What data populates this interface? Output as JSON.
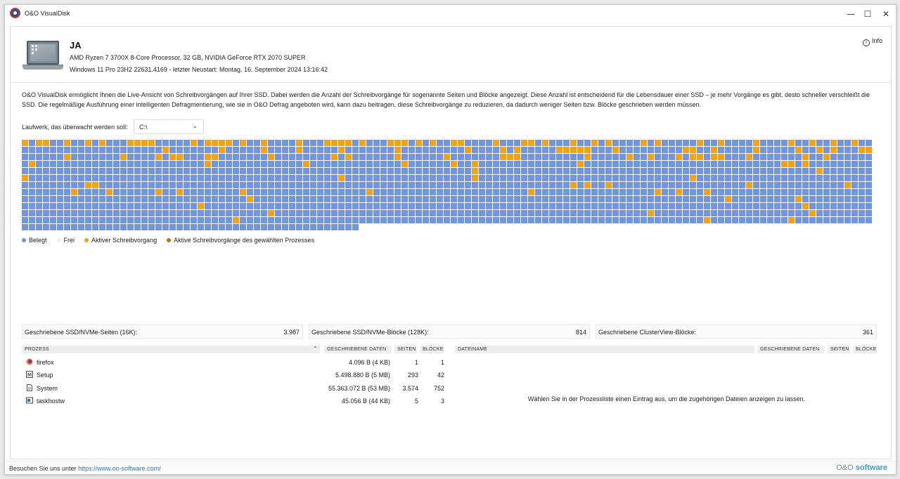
{
  "window": {
    "title": "O&O VisualDisk",
    "minimize_icon": "minimize-icon",
    "maximize_icon": "maximize-icon",
    "close_icon": "close-icon"
  },
  "system": {
    "hostname": "JA",
    "hardware": "AMD Ryzen 7 3700X 8-Core Processor, 32 GB, NVIDIA GeForce RTX 2070 SUPER",
    "os": "Windows 11 Pro 23H2 22631.4169 - letzter Neustart: Montag, 16. September 2024 13:16:42"
  },
  "info_label": "Info",
  "description": "O&O VisualDisk ermöglicht Ihnen die Live-Ansicht von Schreibvorgängen auf Ihrer SSD. Dabei werden die Anzahl der Schreibvorgänge für sogenannte Seiten und Blöcke angezeigt. Diese Anzahl ist entscheidend für die Lebensdauer einer SSD – je mehr Vorgänge es gibt, desto schneller verschleißt die SSD. Die regelmäßige Ausführung einer intelligenten Defragmentierung, wie sie in O&O Defrag angeboten wird, kann dazu beitragen, diese Schreibvorgänge zu reduzieren, da dadurch weniger Seiten bzw. Blöcke geschrieben werden müssen.",
  "drive": {
    "label": "Laufwerk, das überwacht werden soll:",
    "selected": "C:\\"
  },
  "cluster_map": {
    "columns": 121,
    "full_rows": 12,
    "last_row_cells": 48,
    "colors": {
      "used": "#6f95e4",
      "active": "#f6a20a"
    },
    "active_cells": [
      [
        0,
        0
      ],
      [
        0,
        2
      ],
      [
        0,
        3
      ],
      [
        0,
        6
      ],
      [
        0,
        9
      ],
      [
        0,
        11
      ],
      [
        0,
        15
      ],
      [
        0,
        16
      ],
      [
        0,
        17
      ],
      [
        0,
        18
      ],
      [
        0,
        24
      ],
      [
        0,
        26
      ],
      [
        0,
        27
      ],
      [
        0,
        28
      ],
      [
        0,
        29
      ],
      [
        0,
        31
      ],
      [
        0,
        34
      ],
      [
        0,
        39
      ],
      [
        0,
        43
      ],
      [
        0,
        44
      ],
      [
        0,
        45
      ],
      [
        0,
        46
      ],
      [
        0,
        48
      ],
      [
        0,
        52
      ],
      [
        0,
        53
      ],
      [
        0,
        54
      ],
      [
        0,
        56
      ],
      [
        0,
        58
      ],
      [
        0,
        61
      ],
      [
        0,
        62
      ],
      [
        0,
        67
      ],
      [
        0,
        71
      ],
      [
        0,
        72
      ],
      [
        0,
        74
      ],
      [
        0,
        78
      ],
      [
        0,
        81
      ],
      [
        0,
        83
      ],
      [
        0,
        88
      ],
      [
        0,
        90
      ],
      [
        0,
        96
      ],
      [
        0,
        99
      ],
      [
        0,
        104
      ],
      [
        0,
        109
      ],
      [
        0,
        112
      ],
      [
        0,
        115
      ],
      [
        0,
        118
      ],
      [
        1,
        20
      ],
      [
        1,
        28
      ],
      [
        1,
        34
      ],
      [
        1,
        39
      ],
      [
        1,
        45
      ],
      [
        1,
        53
      ],
      [
        1,
        63
      ],
      [
        1,
        68
      ],
      [
        1,
        70
      ],
      [
        1,
        76
      ],
      [
        1,
        77
      ],
      [
        1,
        78
      ],
      [
        1,
        79
      ],
      [
        1,
        80
      ],
      [
        1,
        84
      ],
      [
        1,
        94
      ],
      [
        1,
        95
      ],
      [
        1,
        98
      ],
      [
        1,
        104
      ],
      [
        1,
        110
      ],
      [
        1,
        113
      ],
      [
        1,
        115
      ],
      [
        1,
        119
      ],
      [
        1,
        120
      ],
      [
        2,
        6
      ],
      [
        2,
        14
      ],
      [
        2,
        19
      ],
      [
        2,
        21
      ],
      [
        2,
        22
      ],
      [
        2,
        26
      ],
      [
        2,
        27
      ],
      [
        2,
        35
      ],
      [
        2,
        44
      ],
      [
        2,
        46
      ],
      [
        2,
        53
      ],
      [
        2,
        60
      ],
      [
        2,
        68
      ],
      [
        2,
        69
      ],
      [
        2,
        70
      ],
      [
        2,
        80
      ],
      [
        2,
        86
      ],
      [
        2,
        89
      ],
      [
        2,
        93
      ],
      [
        2,
        95
      ],
      [
        2,
        96
      ],
      [
        2,
        98
      ],
      [
        2,
        99
      ],
      [
        2,
        103
      ],
      [
        2,
        111
      ],
      [
        2,
        114
      ],
      [
        3,
        1
      ],
      [
        3,
        26
      ],
      [
        3,
        40
      ],
      [
        3,
        54
      ],
      [
        3,
        61
      ],
      [
        3,
        64
      ],
      [
        3,
        79
      ],
      [
        3,
        108
      ],
      [
        3,
        109
      ],
      [
        3,
        111
      ],
      [
        4,
        64
      ],
      [
        4,
        113
      ],
      [
        5,
        0
      ],
      [
        5,
        45
      ],
      [
        5,
        64
      ],
      [
        5,
        95
      ],
      [
        6,
        9
      ],
      [
        6,
        10
      ],
      [
        6,
        78
      ],
      [
        6,
        80
      ],
      [
        6,
        83
      ],
      [
        6,
        103
      ],
      [
        6,
        117
      ],
      [
        7,
        7
      ],
      [
        7,
        12
      ],
      [
        7,
        19
      ],
      [
        7,
        22
      ],
      [
        7,
        31
      ],
      [
        7,
        49
      ],
      [
        7,
        72
      ],
      [
        7,
        90
      ],
      [
        7,
        93
      ],
      [
        7,
        97
      ],
      [
        8,
        32
      ],
      [
        8,
        100
      ],
      [
        8,
        110
      ],
      [
        9,
        25
      ],
      [
        9,
        111
      ],
      [
        10,
        35
      ],
      [
        10,
        89
      ],
      [
        10,
        112
      ],
      [
        11,
        30
      ],
      [
        11,
        97
      ],
      [
        11,
        109
      ]
    ]
  },
  "legend": [
    {
      "label": "Belegt",
      "color": "#6f95e4"
    },
    {
      "label": "Frei",
      "color": "#eeeeee"
    },
    {
      "label": "Aktiver Schreibvorgang",
      "color": "#f6a20a"
    },
    {
      "label": "Aktive Schreibvorgänge des gewählten Prozesses",
      "color": "#b8760a"
    }
  ],
  "stats": [
    {
      "label": "Geschriebene SSD/NVMe-Seiten (16K):",
      "value": "3.987"
    },
    {
      "label": "Geschriebene SSD/NVMe-Blöcke (128K):",
      "value": "814"
    },
    {
      "label": "Geschriebene ClusterView-Blöcke:",
      "value": "361"
    }
  ],
  "process_table": {
    "headers": {
      "process": "PROZESS",
      "written": "GESCHRIEBENE DATEN",
      "pages": "SEITEN",
      "blocks": "BLÖCKE"
    },
    "rows": [
      {
        "name": "firefox",
        "icon": "firefox-icon",
        "written": "4.096 B (4 KB)",
        "pages": "1",
        "blocks": "1"
      },
      {
        "name": "Setup",
        "icon": "setup-icon",
        "written": "5.498.880 B (5 MB)",
        "pages": "293",
        "blocks": "42"
      },
      {
        "name": "System",
        "icon": "system-icon",
        "written": "55.363.072 B (53 MB)",
        "pages": "3.574",
        "blocks": "752"
      },
      {
        "name": "taskhostw",
        "icon": "taskhostw-icon",
        "written": "45.056 B (44 KB)",
        "pages": "5",
        "blocks": "3"
      }
    ]
  },
  "file_table": {
    "headers": {
      "filename": "DATEINAME",
      "written": "GESCHRIEBENE DATEN",
      "pages": "SEITEN",
      "blocks": "BLÖCKE"
    },
    "empty_hint": "Wählen Sie in der Prozessliste einen Eintrag aus, um die zugehörigen Dateien anzeigen zu lassen."
  },
  "footer": {
    "visit_text": "Besuchen Sie uns unter",
    "link": "https://www.oo-software.com/",
    "brand_prefix": "O&O",
    "brand_suffix": "software"
  }
}
